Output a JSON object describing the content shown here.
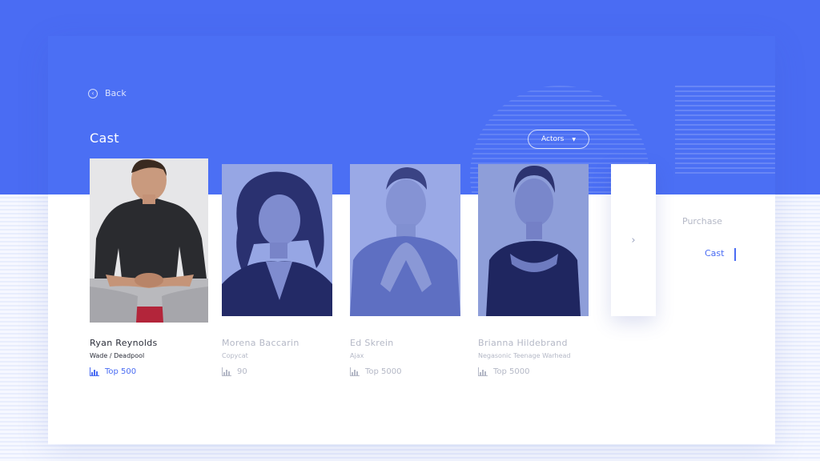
{
  "header": {
    "back_label": "Back",
    "section_title": "Cast",
    "filter_label": "Actors"
  },
  "cast": [
    {
      "name": "Ryan Reynolds",
      "role": "Wade / Deadpool",
      "rank": "Top 500",
      "active": true
    },
    {
      "name": "Morena Baccarin",
      "role": "Copycat",
      "rank": "90",
      "active": false
    },
    {
      "name": "Ed Skrein",
      "role": "Ajax",
      "rank": "Top 5000",
      "active": false
    },
    {
      "name": "Brianna Hildebrand",
      "role": "Negasonic Teenage Warhead",
      "rank": "Top 5000",
      "active": false
    }
  ],
  "side_nav": {
    "items": [
      "Purchase",
      "Cast"
    ],
    "active": "Cast"
  },
  "colors": {
    "accent": "#4a6cf3",
    "panel_top": "#4b6ff4",
    "text_dark": "#2b2e3a",
    "text_muted": "#b4b8c6"
  },
  "icons": {
    "back": "chevron-left-icon",
    "filter_caret": "caret-down-icon",
    "next": "chevron-right-icon",
    "rank": "bar-chart-icon"
  }
}
